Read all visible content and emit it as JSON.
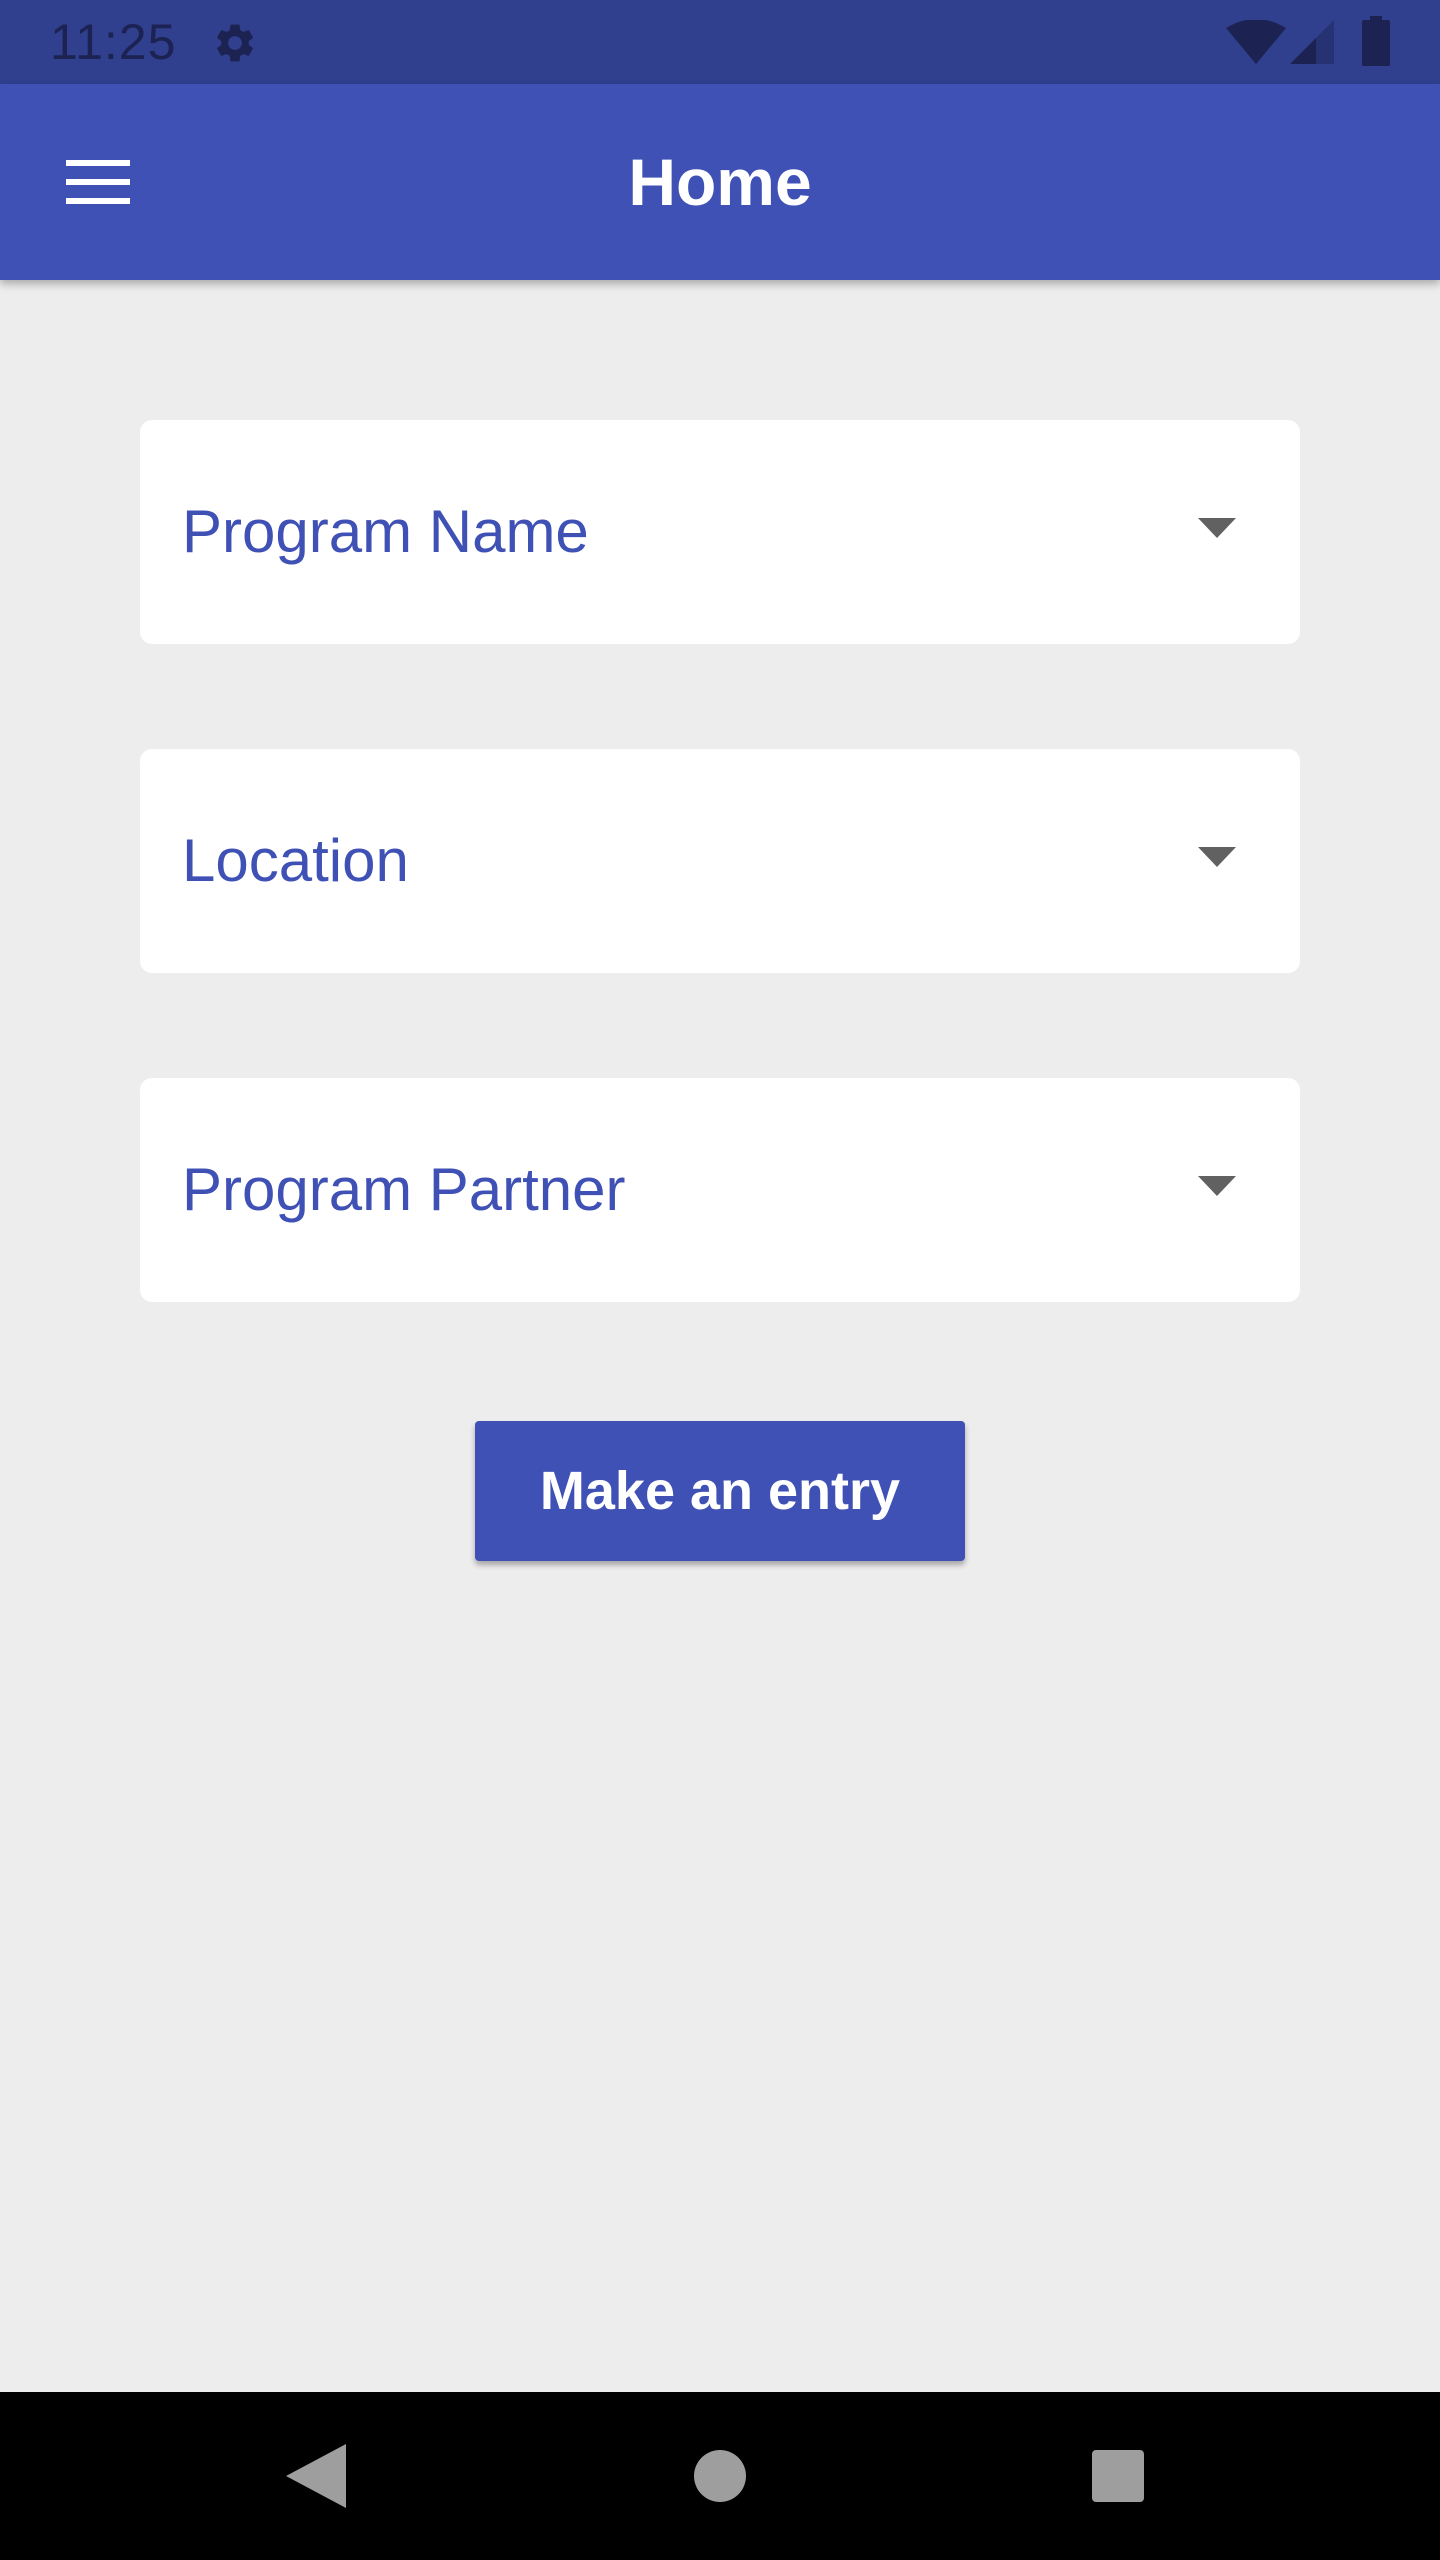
{
  "status_bar": {
    "time": "11:25",
    "icons": [
      "gear-icon",
      "wifi-icon",
      "signal-icon",
      "battery-icon"
    ]
  },
  "app_bar": {
    "title": "Home",
    "menu_icon": "hamburger-menu-icon"
  },
  "form": {
    "fields": [
      {
        "label": "Program Name",
        "icon": "dropdown-arrow-icon"
      },
      {
        "label": "Location",
        "icon": "dropdown-arrow-icon"
      },
      {
        "label": "Program Partner",
        "icon": "dropdown-arrow-icon"
      }
    ],
    "submit_label": "Make an entry"
  },
  "nav_bar": {
    "icons": [
      "back-icon",
      "home-icon",
      "recents-icon"
    ]
  },
  "colors": {
    "status_bar": "#303f8e",
    "primary": "#3f51b5",
    "background": "#ededed",
    "card": "#ffffff",
    "arrow": "#616161",
    "nav_bar": "#000000"
  }
}
